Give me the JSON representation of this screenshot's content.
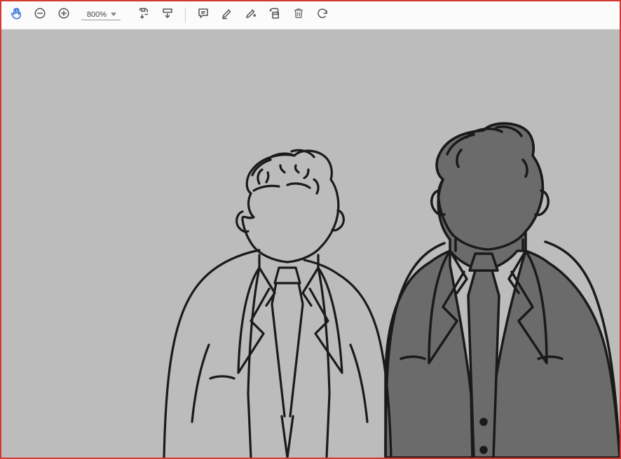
{
  "toolbar": {
    "hand_tool": "hand-tool",
    "zoom_out": "zoom-out",
    "zoom_in": "zoom-in",
    "zoom_value": "800%",
    "save": "save",
    "insert": "insert",
    "comment": "comment",
    "highlight": "highlight",
    "erase": "erase",
    "crop": "crop",
    "delete": "delete",
    "rotate": "rotate"
  },
  "canvas": {
    "content_description": "line-drawing-two-men-in-suits"
  }
}
